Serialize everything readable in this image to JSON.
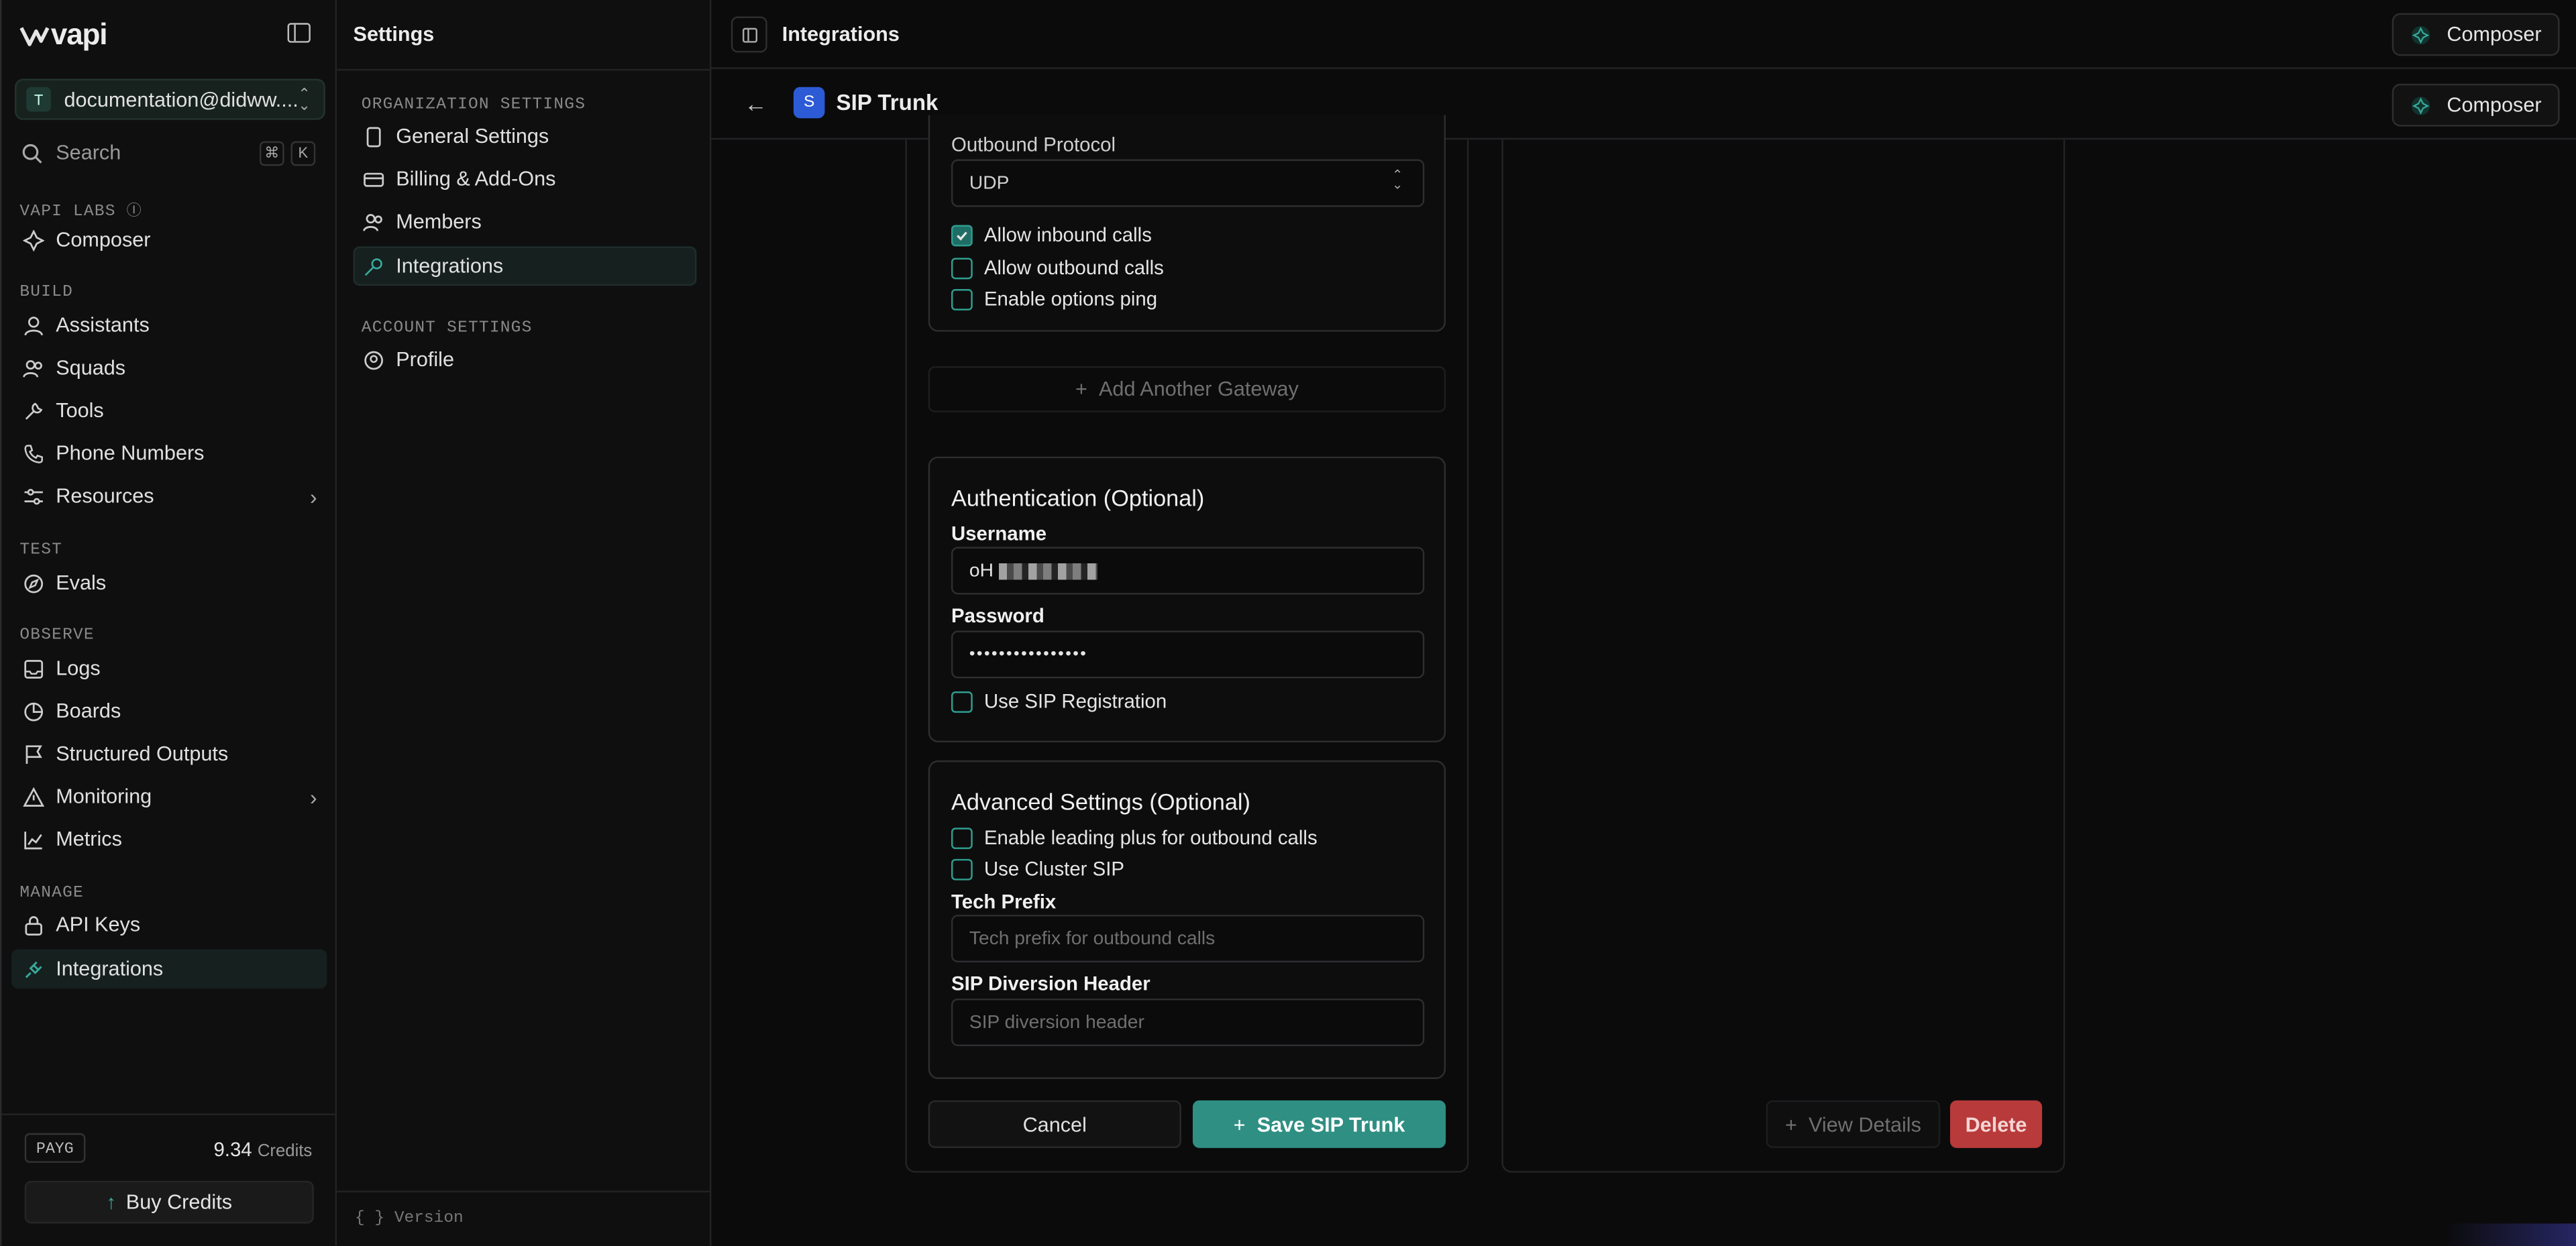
{
  "brand": {
    "logo_text": "vapi"
  },
  "org": {
    "avatar_letter": "T",
    "name": "documentation@didww...."
  },
  "search": {
    "placeholder": "Search",
    "shortcut_cmd": "⌘",
    "shortcut_key": "K"
  },
  "sidebar": {
    "sections": [
      {
        "label": "VAPI LABS",
        "items": [
          {
            "label": "Composer",
            "icon": "composer-icon"
          }
        ]
      },
      {
        "label": "BUILD",
        "items": [
          {
            "label": "Assistants",
            "icon": "user-icon"
          },
          {
            "label": "Squads",
            "icon": "users-icon"
          },
          {
            "label": "Tools",
            "icon": "wrench-icon"
          },
          {
            "label": "Phone Numbers",
            "icon": "phone-icon"
          },
          {
            "label": "Resources",
            "icon": "sliders-icon"
          }
        ]
      },
      {
        "label": "TEST",
        "items": [
          {
            "label": "Evals",
            "icon": "compass-icon"
          }
        ]
      },
      {
        "label": "OBSERVE",
        "items": [
          {
            "label": "Logs",
            "icon": "inbox-icon"
          },
          {
            "label": "Boards",
            "icon": "pie-icon"
          },
          {
            "label": "Structured Outputs",
            "icon": "flag-icon"
          },
          {
            "label": "Monitoring",
            "icon": "alert-icon"
          },
          {
            "label": "Metrics",
            "icon": "chart-icon"
          }
        ]
      },
      {
        "label": "MANAGE",
        "items": [
          {
            "label": "API Keys",
            "icon": "lock-icon"
          },
          {
            "label": "Integrations",
            "icon": "plug-icon"
          }
        ]
      }
    ],
    "plan_badge": "PAYG",
    "credits_value": "9.34",
    "credits_label": "Credits",
    "buy_credits": "Buy Credits"
  },
  "settings": {
    "title": "Settings",
    "org_section": "ORGANIZATION SETTINGS",
    "org_items": [
      "General Settings",
      "Billing & Add-Ons",
      "Members",
      "Integrations"
    ],
    "account_section": "ACCOUNT SETTINGS",
    "account_items": [
      "Profile"
    ],
    "version_label": "Version"
  },
  "header": {
    "title": "Integrations",
    "composer": "Composer"
  },
  "subheader": {
    "badge_letter": "S",
    "title": "SIP Trunk",
    "composer": "Composer"
  },
  "gateway": {
    "protocol_label": "Outbound Protocol",
    "protocol_value": "UDP",
    "allow_inbound": "Allow inbound calls",
    "allow_outbound": "Allow outbound calls",
    "options_ping": "Enable options ping",
    "add_gateway": "Add Another Gateway"
  },
  "auth": {
    "title": "Authentication (Optional)",
    "username_label": "Username",
    "username_value": "oH",
    "password_label": "Password",
    "password_value": "••••••••••••••••",
    "sip_registration": "Use SIP Registration"
  },
  "advanced": {
    "title": "Advanced Settings (Optional)",
    "leading_plus": "Enable leading plus for outbound calls",
    "cluster_sip": "Use Cluster SIP",
    "tech_prefix_label": "Tech Prefix",
    "tech_prefix_placeholder": "Tech prefix for outbound calls",
    "diversion_label": "SIP Diversion Header",
    "diversion_placeholder": "SIP diversion header"
  },
  "actions": {
    "cancel": "Cancel",
    "save": "Save SIP Trunk",
    "view_details": "View Details",
    "delete": "Delete"
  },
  "colors": {
    "accent": "#2f8f83",
    "delete": "#b83a3a",
    "badge": "#2d5bd6"
  }
}
